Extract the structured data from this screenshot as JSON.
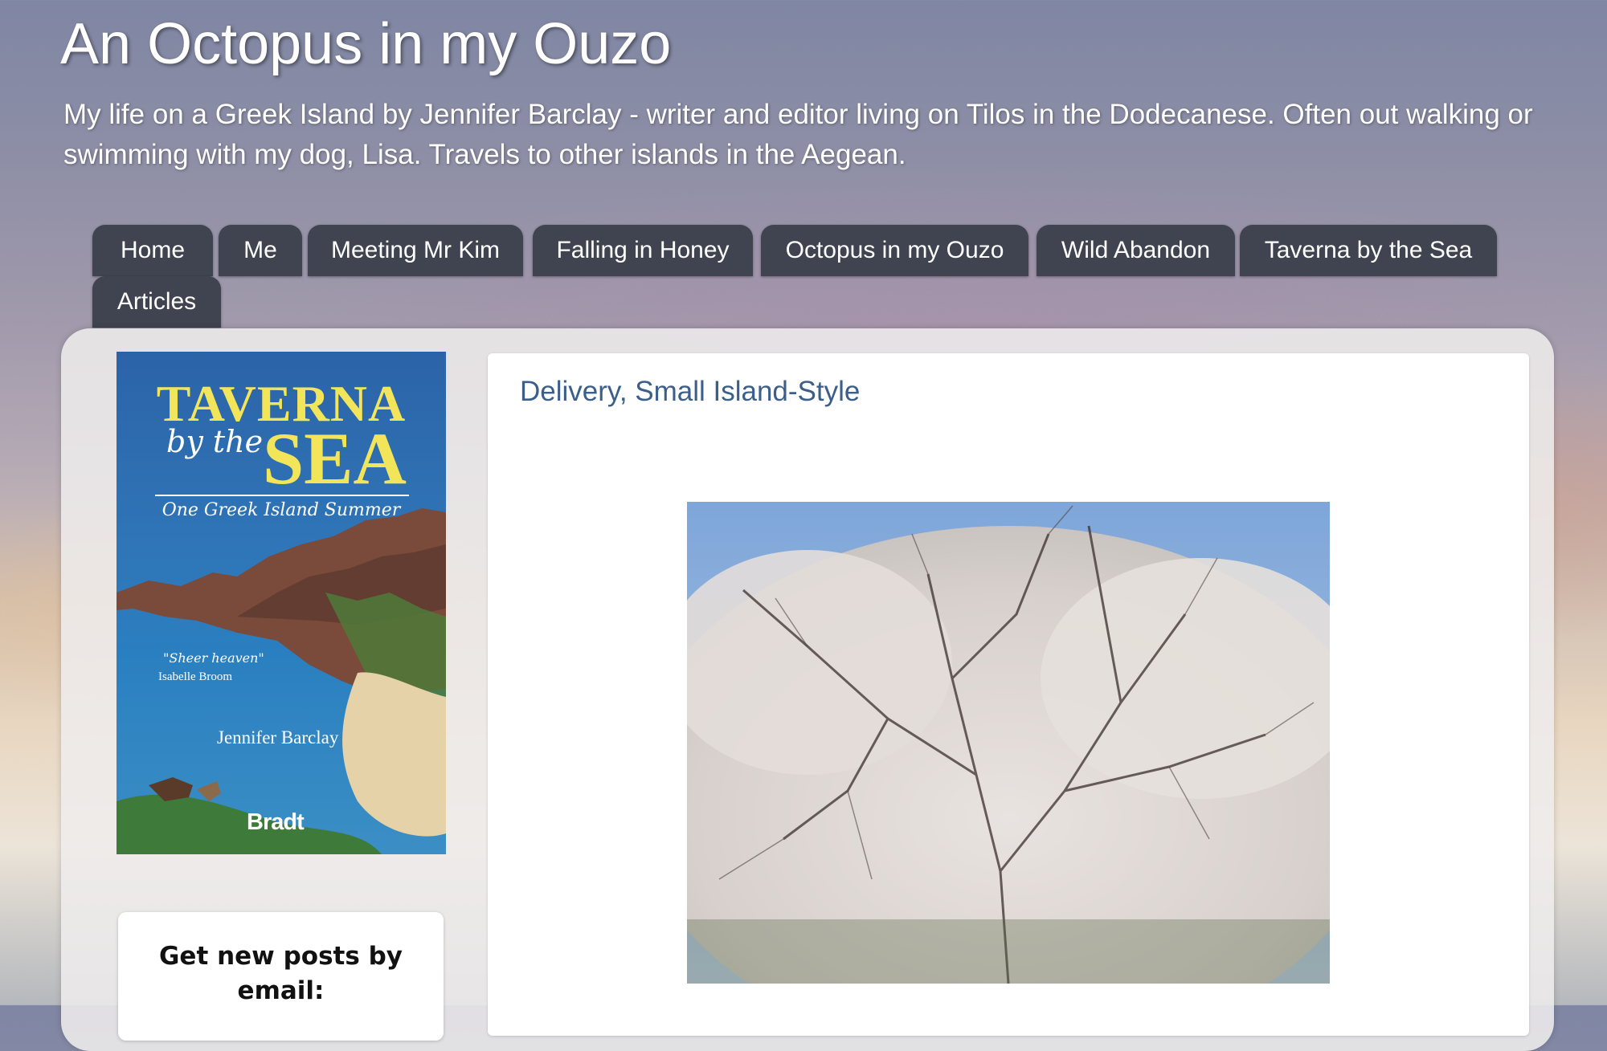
{
  "site": {
    "title": "An Octopus in my Ouzo",
    "description": "My life on a Greek Island by Jennifer Barclay - writer and editor living on Tilos in the Dodecanese. Often out walking or swimming with my dog, Lisa. Travels to other islands in the Aegean."
  },
  "nav": {
    "tabs": [
      {
        "label": "Home"
      },
      {
        "label": "Me"
      },
      {
        "label": "Meeting Mr Kim"
      },
      {
        "label": "Falling in Honey"
      },
      {
        "label": "Octopus in my Ouzo"
      },
      {
        "label": "Wild Abandon"
      },
      {
        "label": "Taverna by the Sea"
      },
      {
        "label": "Articles"
      }
    ]
  },
  "sidebar": {
    "book": {
      "title_line1": "TAVERNA",
      "title_line2a": "by the",
      "title_line2b": "SEA",
      "subtitle": "One Greek Island Summer",
      "quote": "\"Sheer heaven\"",
      "quote_author": "Isabelle Broom",
      "author": "Jennifer Barclay",
      "publisher": "Bradt"
    },
    "email_widget": {
      "title": "Get new posts by email:"
    }
  },
  "post": {
    "title": "Delivery, Small Island-Style",
    "image_icon": "blossom-tree-photo"
  },
  "colors": {
    "tab_bg": "#3f4450",
    "post_title": "#3b5f8a",
    "book_title_yellow": "#f3e55a"
  }
}
